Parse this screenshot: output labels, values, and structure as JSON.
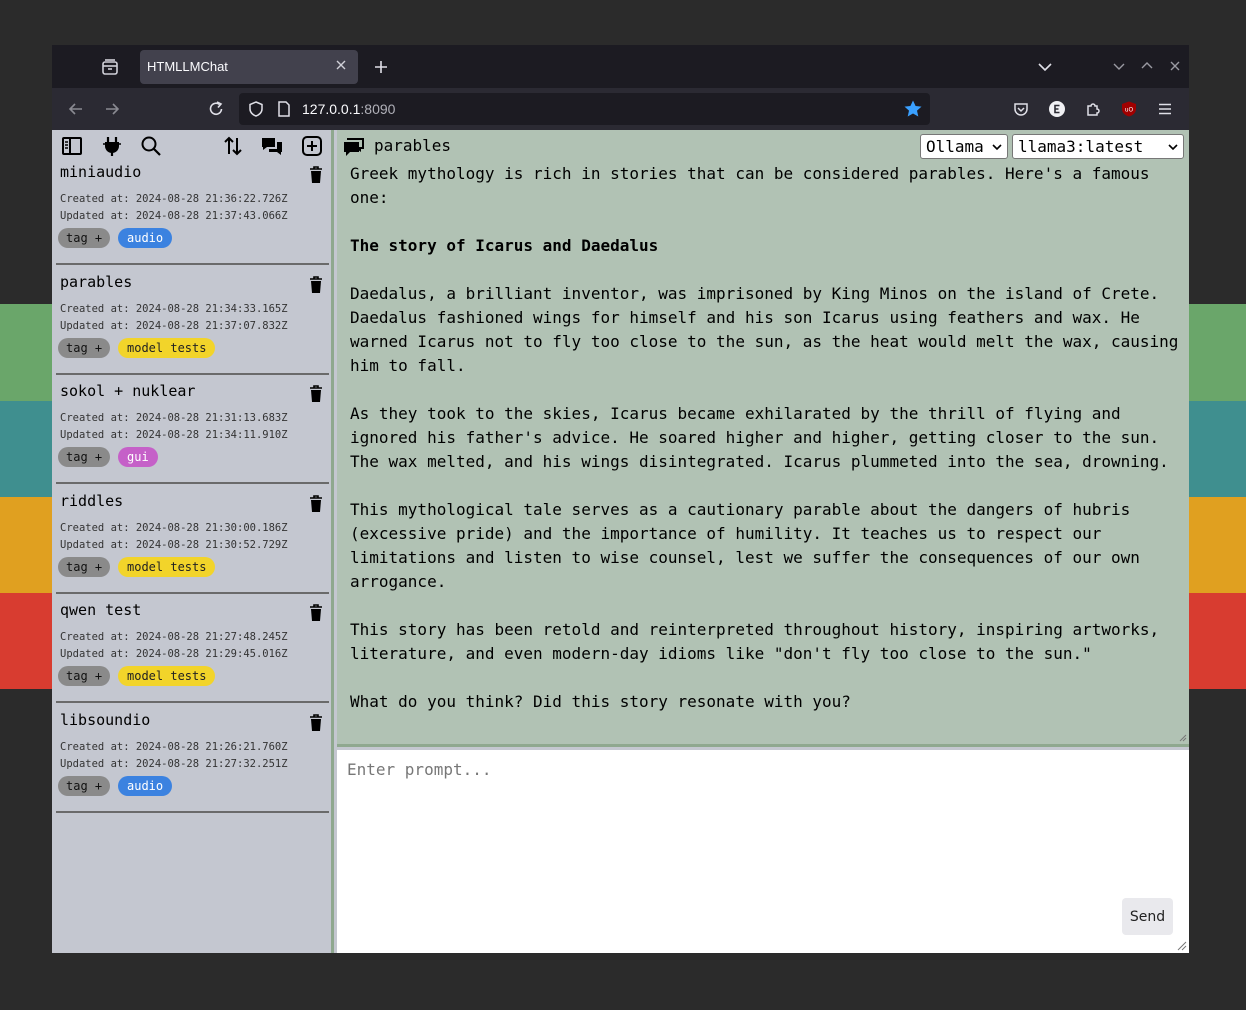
{
  "browser": {
    "tab_title": "HTMLLMChat",
    "url_host": "127.0.0.1",
    "url_port": ":8090"
  },
  "sidebar": {
    "conversations": [
      {
        "title": "miniaudio",
        "created": "Created at: 2024-08-28 21:36:22.726Z",
        "updated": "Updated at: 2024-08-28 21:37:43.066Z",
        "tag_add": "tag +",
        "tag": "audio",
        "tag_color": "#3b82e0"
      },
      {
        "title": "parables",
        "created": "Created at: 2024-08-28 21:34:33.165Z",
        "updated": "Updated at: 2024-08-28 21:37:07.832Z",
        "tag_add": "tag +",
        "tag": "model tests",
        "tag_color": "#f2d42a"
      },
      {
        "title": "sokol + nuklear",
        "created": "Created at: 2024-08-28 21:31:13.683Z",
        "updated": "Updated at: 2024-08-28 21:34:11.910Z",
        "tag_add": "tag +",
        "tag": "gui",
        "tag_color": "#c560c8"
      },
      {
        "title": "riddles",
        "created": "Created at: 2024-08-28 21:30:00.186Z",
        "updated": "Updated at: 2024-08-28 21:30:52.729Z",
        "tag_add": "tag +",
        "tag": "model tests",
        "tag_color": "#f2d42a"
      },
      {
        "title": "qwen test",
        "created": "Created at: 2024-08-28 21:27:48.245Z",
        "updated": "Updated at: 2024-08-28 21:29:45.016Z",
        "tag_add": "tag +",
        "tag": "model tests",
        "tag_color": "#f2d42a"
      },
      {
        "title": "libsoundio",
        "created": "Created at: 2024-08-28 21:26:21.760Z",
        "updated": "Updated at: 2024-08-28 21:27:32.251Z",
        "tag_add": "tag +",
        "tag": "audio",
        "tag_color": "#3b82e0"
      }
    ]
  },
  "chat": {
    "title": "parables",
    "provider": "Ollama",
    "model": "llama3:latest",
    "message": {
      "p1": "Greek mythology is rich in stories that can be considered parables. Here's a famous one:",
      "p2": "The story of Icarus and Daedalus",
      "p3": "Daedalus, a brilliant inventor, was imprisoned by King Minos on the island of Crete. Daedalus fashioned wings for himself and his son Icarus using feathers and wax. He warned Icarus not to fly too close to the sun, as the heat would melt the wax, causing him to fall.",
      "p4": "As they took to the skies, Icarus became exhilarated by the thrill of flying and ignored his father's advice. He soared higher and higher, getting closer to the sun. The wax melted, and his wings disintegrated. Icarus plummeted into the sea, drowning.",
      "p5": "This mythological tale serves as a cautionary parable about the dangers of hubris (excessive pride) and the importance of humility. It teaches us to respect our limitations and listen to wise counsel, lest we suffer the consequences of our own arrogance.",
      "p6": "This story has been retold and reinterpreted throughout history, inspiring artworks, literature, and even modern-day idioms like \"don't fly too close to the sun.\"",
      "p7": "What do you think? Did this story resonate with you?"
    },
    "prompt_placeholder": "Enter prompt...",
    "send_label": "Send"
  }
}
